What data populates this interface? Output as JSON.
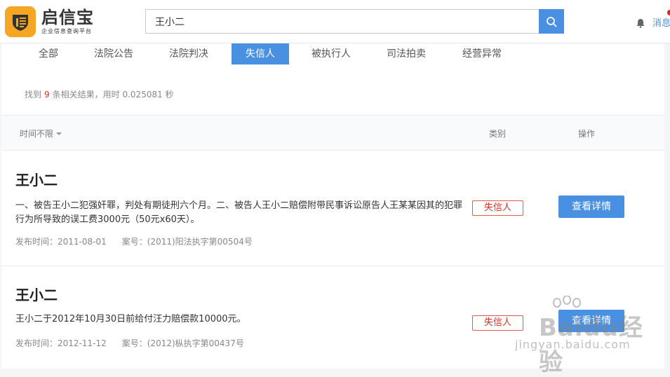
{
  "header": {
    "logo_name": "启信宝",
    "logo_subtitle": "企业信息查询平台",
    "search_value": "王小二",
    "messages_label": "消息"
  },
  "tabs": [
    {
      "label": "全部",
      "active": false
    },
    {
      "label": "法院公告",
      "active": false
    },
    {
      "label": "法院判决",
      "active": false
    },
    {
      "label": "失信人",
      "active": true
    },
    {
      "label": "被执行人",
      "active": false
    },
    {
      "label": "司法拍卖",
      "active": false
    },
    {
      "label": "经营异常",
      "active": false
    }
  ],
  "summary": {
    "prefix": "找到",
    "count": "9",
    "suffix": "条相关结果，用时 0.025081 秒"
  },
  "filter": {
    "time_label": "时间不限",
    "category_header": "类别",
    "action_header": "操作"
  },
  "results": [
    {
      "title": "王小二",
      "description": "一、被告王小二犯强奸罪，判处有期徒刑六个月。二、被告人王小二赔偿附带民事诉讼原告人王某某因其的犯罪行为所导致的误工费3000元（50元x60天）。",
      "publish_time": "发布时间：2011-08-01",
      "case_no": "案号：(2011)阳法执字第00504号",
      "category": "失信人",
      "action": "查看详情"
    },
    {
      "title": "王小二",
      "description": "王小二于2012年10月30日前给付汪力赔偿款10000元。",
      "publish_time": "发布时间：2012-11-12",
      "case_no": "案号：(2012)枞执字第00437号",
      "category": "失信人",
      "action": "查看详情"
    }
  ],
  "watermark": {
    "brand": "Baidu经验",
    "url": "jingyan.baidu.com"
  },
  "colors": {
    "accent": "#4a90e2",
    "logo": "#f5a623",
    "danger": "#d93025"
  }
}
